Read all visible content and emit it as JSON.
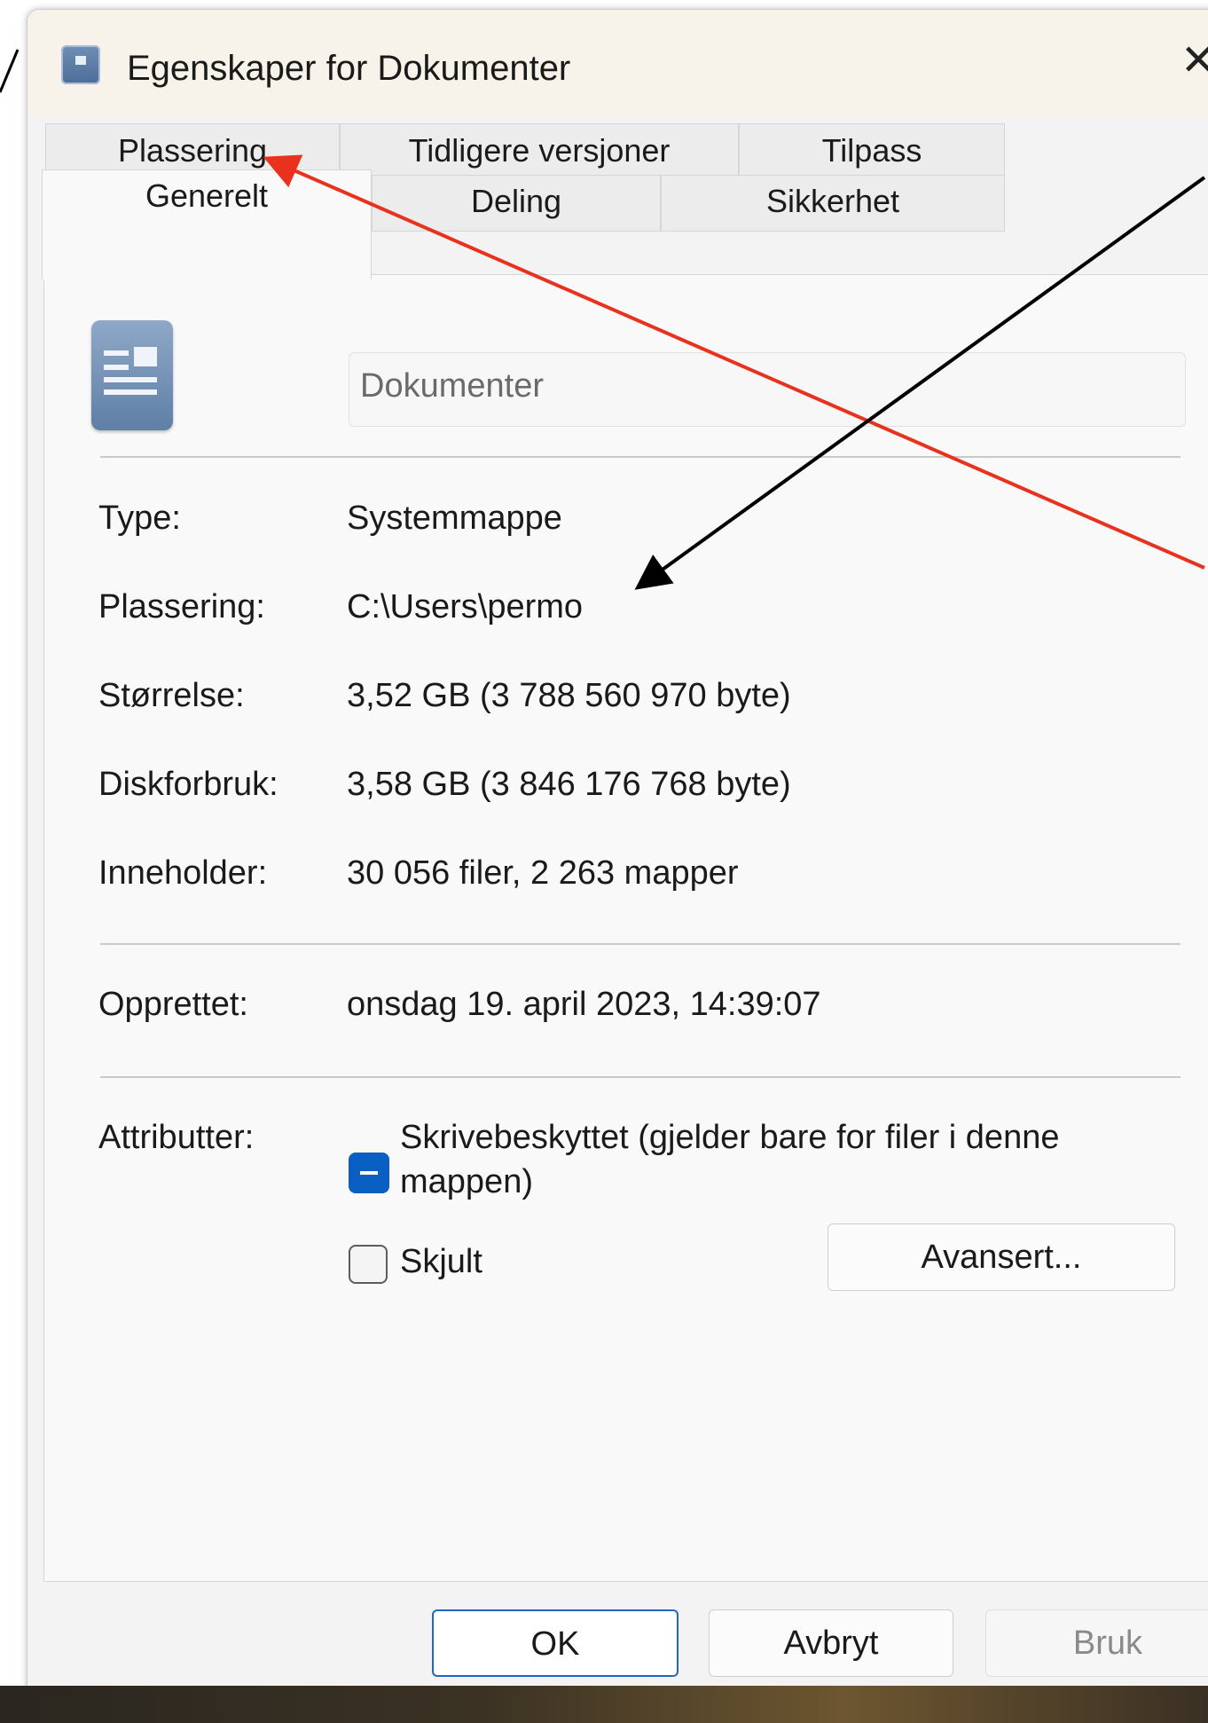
{
  "window": {
    "title": "Egenskaper for Dokumenter",
    "close_glyph": "✕",
    "icon": "folder-properties-icon"
  },
  "tabs": {
    "back_row": [
      {
        "label": "Plassering"
      },
      {
        "label": "Tidligere versjoner"
      },
      {
        "label": "Tilpass"
      }
    ],
    "front_row": [
      {
        "label": "Generelt",
        "active": true
      },
      {
        "label": "Deling"
      },
      {
        "label": "Sikkerhet"
      }
    ]
  },
  "general": {
    "folder_name": "Dokumenter",
    "folder_icon": "document-folder-icon",
    "properties": [
      {
        "label": "Type:",
        "value": "Systemmappe"
      },
      {
        "label": "Plassering:",
        "value": "C:\\Users\\permo"
      },
      {
        "label": "Størrelse:",
        "value": "3,52 GB (3 788 560 970 byte)"
      },
      {
        "label": "Diskforbruk:",
        "value": "3,58 GB (3 846 176 768 byte)"
      },
      {
        "label": "Inneholder:",
        "value": "30 056 filer, 2 263 mapper"
      }
    ],
    "created": {
      "label": "Opprettet:",
      "value": "onsdag 19. april 2023, 14:39:07"
    },
    "attributes": {
      "label": "Attributter:",
      "readonly_line1": "Skrivebeskyttet (gjelder bare for filer i denne",
      "readonly_line2": "mappen)",
      "readonly_state": "indeterminate",
      "hidden_label": "Skjult",
      "hidden_checked": false,
      "advanced_button": "Avansert..."
    }
  },
  "footer": {
    "ok": "OK",
    "cancel": "Avbryt",
    "apply": "Bruk"
  },
  "annotations": {
    "red_arrow_color": "#e8321e",
    "black_arrow_color": "#000000"
  }
}
